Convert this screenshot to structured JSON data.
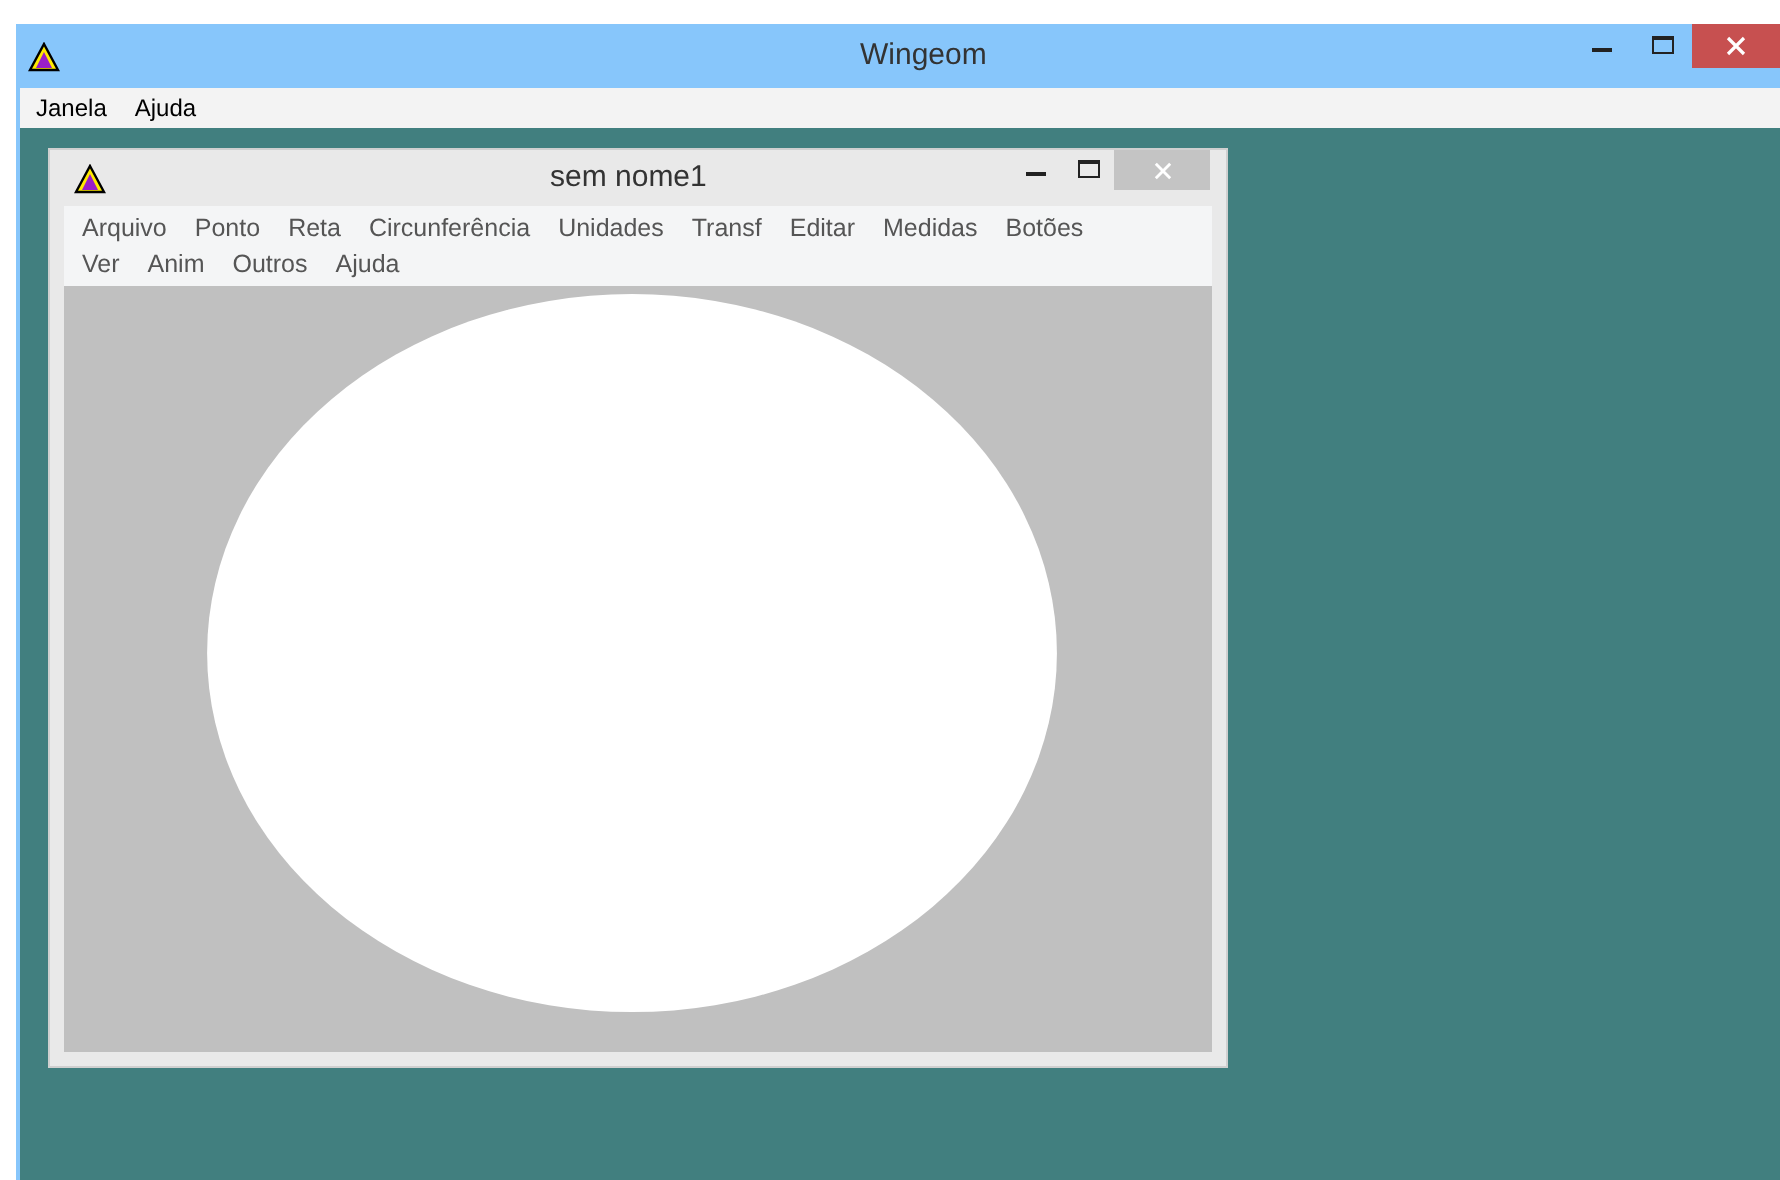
{
  "window": {
    "title": "Wingeom"
  },
  "menu": [
    "Janela",
    "Ajuda"
  ],
  "document_window": {
    "title": "sem nome1",
    "menu": [
      "Arquivo",
      "Ponto",
      "Reta",
      "Circunferência",
      "Unidades",
      "Transf",
      "Editar",
      "Medidas",
      "Botões",
      "Ver",
      "Anim",
      "Outros",
      "Ajuda"
    ]
  }
}
